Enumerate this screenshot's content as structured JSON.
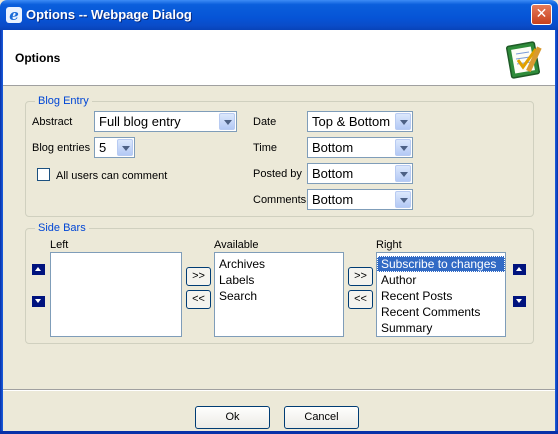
{
  "window": {
    "title": "Options -- Webpage Dialog",
    "close_label": "✕"
  },
  "header": {
    "title": "Options"
  },
  "blog_entry": {
    "group_title": "Blog Entry",
    "abstract": {
      "label": "Abstract",
      "value": "Full blog entry"
    },
    "blog_entries": {
      "label": "Blog entries",
      "value": "5"
    },
    "all_users_comment": {
      "label": "All users can comment",
      "checked": false
    },
    "date": {
      "label": "Date",
      "value": "Top & Bottom"
    },
    "time": {
      "label": "Time",
      "value": "Bottom"
    },
    "posted_by": {
      "label": "Posted by",
      "value": "Bottom"
    },
    "comments": {
      "label": "Comments",
      "value": "Bottom"
    }
  },
  "side_bars": {
    "group_title": "Side Bars",
    "left": {
      "label": "Left",
      "items": []
    },
    "available": {
      "label": "Available",
      "items": [
        "Archives",
        "Labels",
        "Search"
      ]
    },
    "right": {
      "label": "Right",
      "items": [
        "Subscribe to changes",
        "Author",
        "Recent Posts",
        "Recent Comments",
        "Summary"
      ],
      "selected_index": 0
    },
    "add_label": ">>",
    "remove_label": "<<"
  },
  "footer": {
    "ok_label": "Ok",
    "cancel_label": "Cancel"
  }
}
